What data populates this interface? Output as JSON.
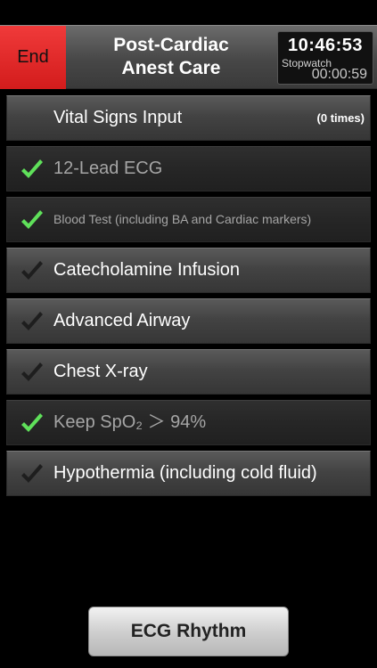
{
  "header": {
    "end_label": "End",
    "title_line1": "Post-Cardiac",
    "title_line2": "Anest Care",
    "clock": "10:46:53",
    "stopwatch_label": "Stopwatch",
    "stopwatch_time": "00:00:59"
  },
  "list": {
    "items": [
      {
        "label": "Vital Signs Input",
        "count": "(0 times)",
        "checked": false,
        "check_color": null
      },
      {
        "label": "12-Lead ECG",
        "checked": true,
        "check_color": "#5fe05a"
      },
      {
        "label": "Blood Test (including BA and Cardiac markers)",
        "checked": true,
        "check_color": "#5fe05a"
      },
      {
        "label": "Catecholamine Infusion",
        "checked": false,
        "check_color": "#1e1e1e"
      },
      {
        "label": "Advanced Airway",
        "checked": false,
        "check_color": "#1e1e1e"
      },
      {
        "label": "Chest X-ray",
        "checked": false,
        "check_color": "#1e1e1e"
      },
      {
        "label": "Keep SpO₂ ＞ 94%",
        "checked": true,
        "check_color": "#5fe05a"
      },
      {
        "label": "Hypothermia (including cold fluid)",
        "checked": false,
        "check_color": "#1e1e1e"
      }
    ]
  },
  "footer": {
    "ecg_rhythm_label": "ECG Rhythm"
  },
  "colors": {
    "end_red": "#e02727",
    "check_green": "#5fe05a",
    "check_dark": "#1e1e1e"
  }
}
